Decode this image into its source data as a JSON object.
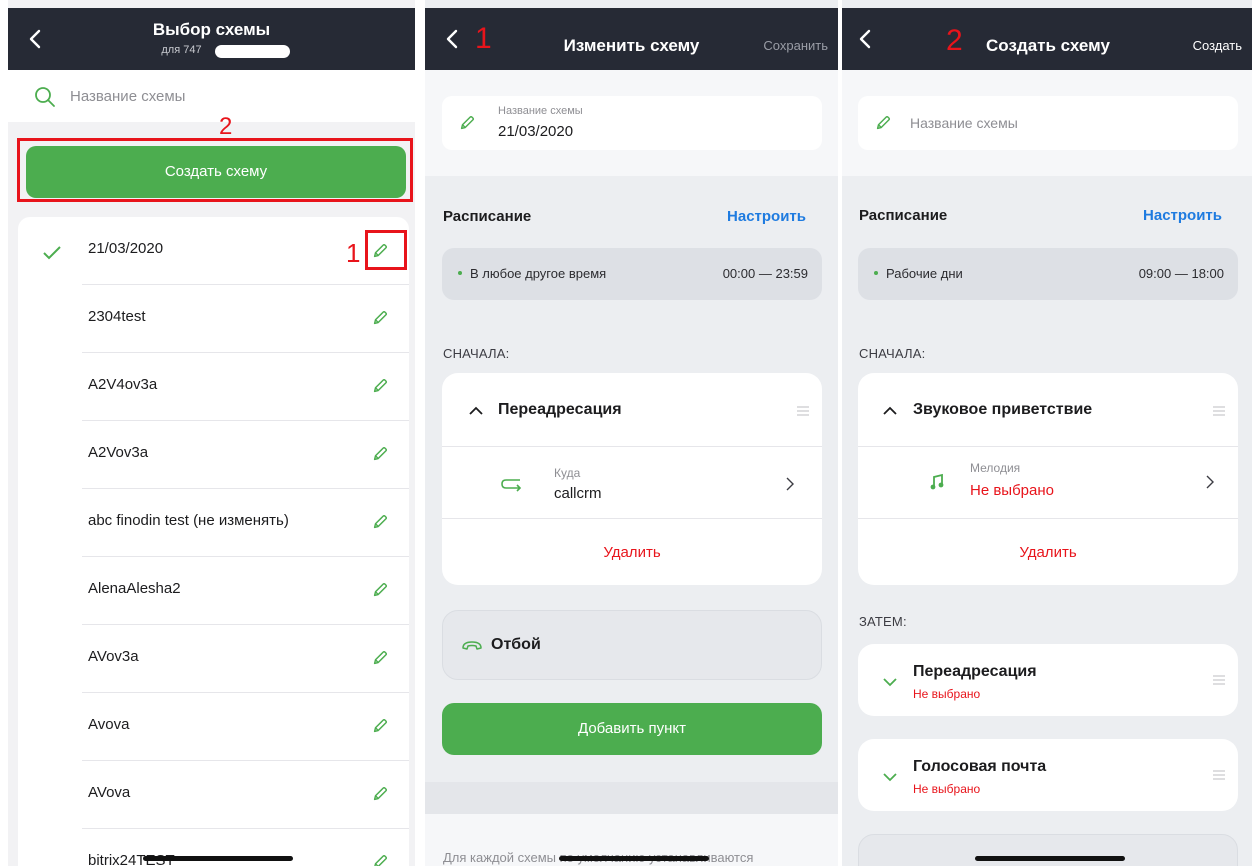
{
  "p1": {
    "title": "Выбор схемы",
    "subtitle": "для 747",
    "search_placeholder": "Название схемы",
    "mark_create": "2",
    "mark_edit": "1",
    "create_button": "Создать схему",
    "schemes": [
      "21/03/2020",
      "2304test",
      "A2V4ov3a",
      "A2Vov3a",
      "abc finodin test (не изменять)",
      "AlenaAlesha2",
      "AVov3a",
      "Avova",
      "AVova",
      "bitrix24TEST"
    ]
  },
  "p2": {
    "title": "Изменить схему",
    "mark": "1",
    "save": "Сохранить",
    "name_label": "Название схемы",
    "name_value": "21/03/2020",
    "schedule_title": "Расписание",
    "schedule_action": "Настроить",
    "schedule_item": "В любое другое время",
    "schedule_time": "00:00 — 23:59",
    "first_label": "СНАЧАЛА:",
    "block_title": "Переадресация",
    "dest_label": "Куда",
    "dest_value": "callcrm",
    "delete": "Удалить",
    "hangup": "Отбой",
    "add_item": "Добавить пункт",
    "footer_note": "Для каждой схемы по умолчанию устанавливаются"
  },
  "p3": {
    "title": "Создать схему",
    "mark": "2",
    "create": "Создать",
    "name_placeholder": "Название схемы",
    "schedule_title": "Расписание",
    "schedule_action": "Настроить",
    "schedule_item": "Рабочие дни",
    "schedule_time": "09:00 — 18:00",
    "first_label": "СНАЧАЛА:",
    "block_title": "Звуковое приветствие",
    "melody_label": "Мелодия",
    "melody_value": "Не выбрано",
    "delete": "Удалить",
    "then_label": "ЗАТЕМ:",
    "then_items": [
      {
        "title": "Переадресация",
        "status": "Не выбрано"
      },
      {
        "title": "Голосовая почта",
        "status": "Не выбрано"
      }
    ]
  },
  "colors": {
    "green": "#4cad4f",
    "blue": "#1e7be0",
    "red": "#e8141b",
    "nav": "#262a35"
  }
}
